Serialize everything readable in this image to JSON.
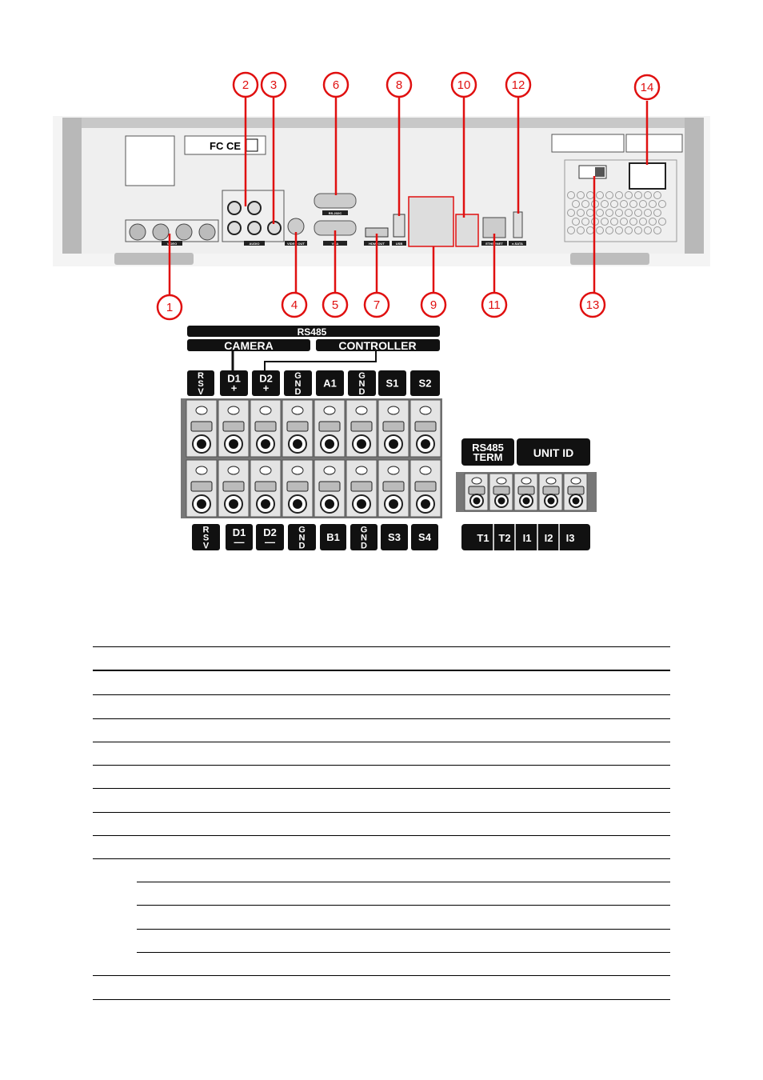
{
  "rear_panel": {
    "callouts_top": [
      "2",
      "3",
      "6",
      "8",
      "10",
      "12",
      "14"
    ],
    "callouts_bottom": [
      "1",
      "4",
      "5",
      "7",
      "9",
      "11",
      "13"
    ],
    "port_labels": {
      "video": "VIDEO",
      "audio": "AUDIO",
      "video_out": "VIDEO OUT",
      "rs232c": "RS-232C",
      "vga": "VGA",
      "hdmi_out": "HDMI OUT",
      "usb": "USB",
      "ethernet": "ETHERNET",
      "esata": "e-SATA"
    },
    "certification_marks": "FC CE",
    "accent_color": "#e01010"
  },
  "terminal_block": {
    "rs485": "RS485",
    "camera": "CAMERA",
    "controller": "CONTROLLER",
    "top_labels": [
      "R S V",
      "D1 +",
      "D2 +",
      "G N D",
      "A1",
      "G N D",
      "S1",
      "S2"
    ],
    "bottom_labels": [
      "R S V",
      "D1 —",
      "D2 —",
      "G N D",
      "B1",
      "G N D",
      "S3",
      "S4"
    ],
    "rs485_term": "RS485 TERM",
    "unit_id": "UNIT ID",
    "unit_labels": [
      "T1",
      "T2",
      "I1",
      "I2",
      "I3"
    ]
  }
}
